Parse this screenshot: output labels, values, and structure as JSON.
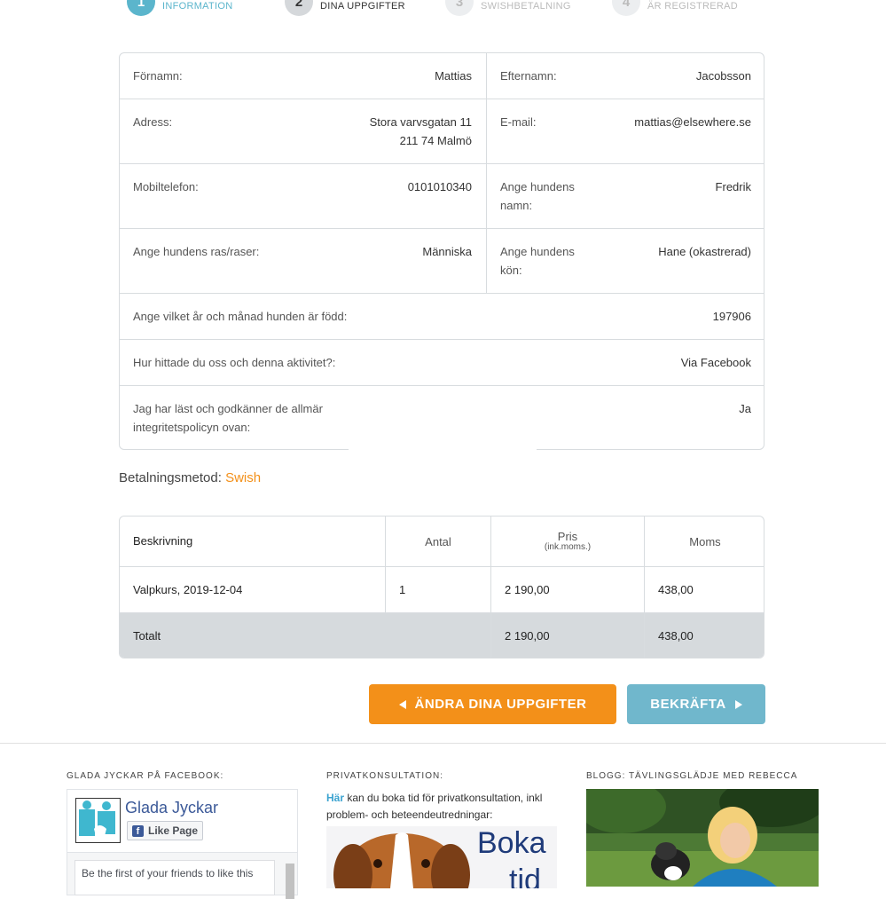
{
  "steps": [
    {
      "num": "1",
      "label": "INFORMATION"
    },
    {
      "num": "2",
      "label": "DINA UPPGIFTER"
    },
    {
      "num": "3",
      "label": "SWISHBETALNING"
    },
    {
      "num": "4",
      "label": "ÄR REGISTRERAD"
    }
  ],
  "info": {
    "fornamn_label": "Förnamn:",
    "fornamn": "Mattias",
    "efternamn_label": "Efternamn:",
    "efternamn": "Jacobsson",
    "adress_label": "Adress:",
    "adress_line1": "Stora varvsgatan 11",
    "adress_line2": "211 74 Malmö",
    "email_label": "E-mail:",
    "email": "mattias@elsewhere.se",
    "mobil_label": "Mobiltelefon:",
    "mobil": "0101010340",
    "hund_namn_label_1": "Ange hundens",
    "hund_namn_label_2": "namn:",
    "hund_namn": "Fredrik",
    "ras_label": "Ange hundens ras/raser:",
    "ras": "Människa",
    "kon_label_1": "Ange hundens",
    "kon_label_2": "kön:",
    "kon": "Hane (okastrerad)",
    "fodd_label": "Ange vilket år och månad hunden är född:",
    "fodd": "197906",
    "hittade_label": "Hur hittade du oss och denna aktivitet?:",
    "hittade": "Via Facebook",
    "villkor_label_1": "Jag har läst och godkänner de allmär",
    "villkor_label_2": "integritetspolicyn ovan:",
    "villkor": "Ja"
  },
  "payment": {
    "label": "Betalningsmetod:",
    "method": "Swish"
  },
  "order": {
    "headers": {
      "beskrivning": "Beskrivning",
      "antal": "Antal",
      "pris": "Pris",
      "pris_sub": "(ink.moms.)",
      "moms": "Moms"
    },
    "rows": [
      {
        "beskrivning": "Valpkurs,  2019-12-04",
        "antal": "1",
        "pris": "2 190,00",
        "moms": "438,00"
      }
    ],
    "total": {
      "label": "Totalt",
      "pris": "2 190,00",
      "moms": "438,00"
    }
  },
  "buttons": {
    "back": "ÄNDRA DINA UPPGIFTER",
    "next": "BEKRÄFTA"
  },
  "footer": {
    "facebook_heading": "GLADA JYCKAR PÅ FACEBOOK:",
    "fb_page_name": "Glada Jyckar",
    "fb_like": "Like Page",
    "fb_friends": "Be the first of your friends to like this",
    "privat_heading": "PRIVATKONSULTATION:",
    "privat_link": "Här",
    "privat_text": " kan du boka tid för privatkonsultation, inkl problem- och beteendeutredningar:",
    "privat_img_text_1": "Boka",
    "privat_img_text_2": "tid",
    "blog_heading": "BLOGG: TÄVLINGSGLÄDJE MED REBECCA"
  },
  "colors": {
    "accent_orange": "#f39019",
    "accent_blue": "#70b7cc",
    "step_active": "#5bb5cc",
    "facebook_blue": "#3b5998"
  }
}
